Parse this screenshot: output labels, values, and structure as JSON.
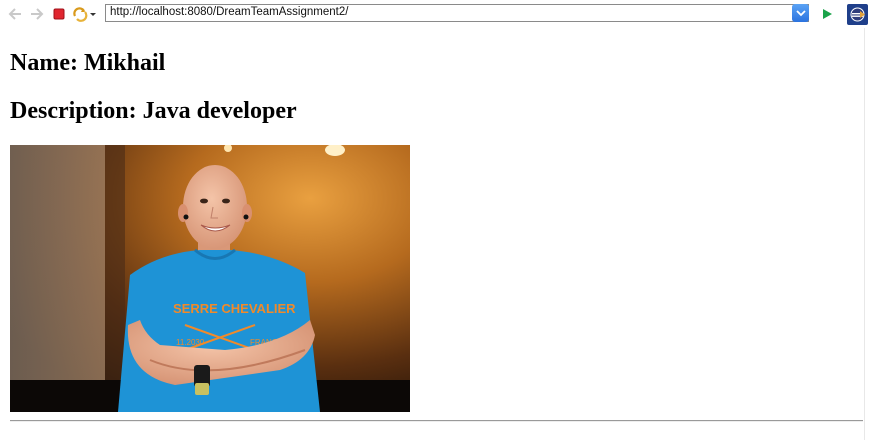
{
  "browser": {
    "url": "http://localhost:8080/DreamTeamAssignment2/",
    "icons": {
      "back": "back-arrow-icon",
      "forward": "forward-arrow-icon",
      "stop": "stop-icon",
      "refresh": "refresh-icon",
      "go": "go-arrow-icon",
      "eclipse": "eclipse-logo-icon"
    },
    "colors": {
      "stop": "#e0262f",
      "go": "#1aa34a",
      "url_dropdown": "#2b73df"
    }
  },
  "page": {
    "name_heading": "Name: Mikhail",
    "description_heading": "Description: Java developer",
    "photo": {
      "subject": "smiling man with arms crossed",
      "shirt_text_1": "SERRE CHEVALIER",
      "shirt_text_2": "FRANCE"
    }
  }
}
